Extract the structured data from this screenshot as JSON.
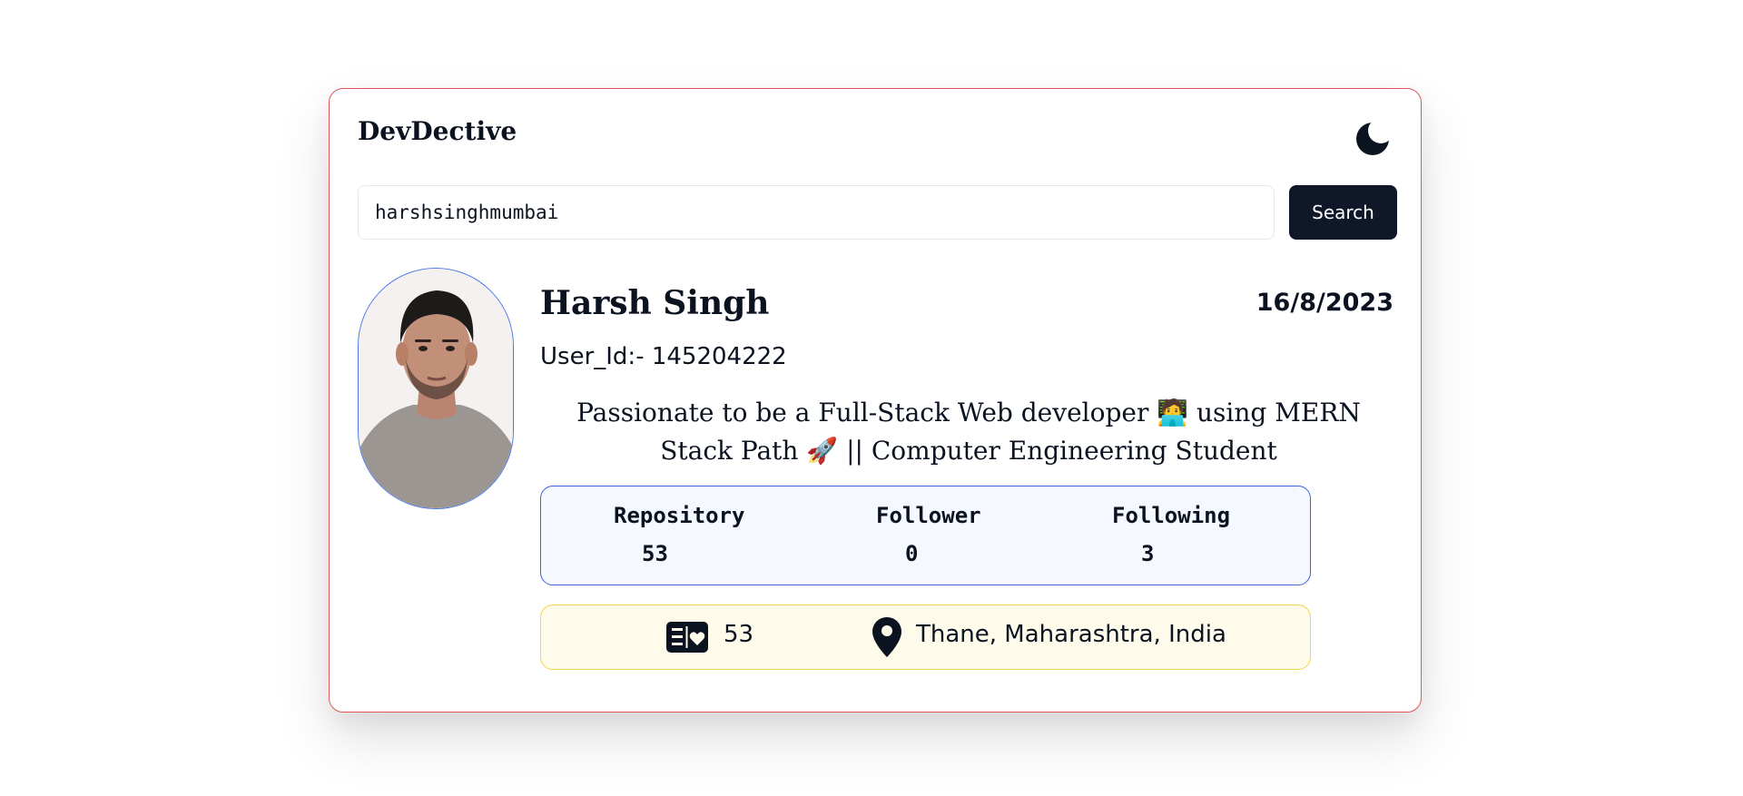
{
  "app": {
    "title": "DevDective"
  },
  "search": {
    "value": "harshsinghmumbai",
    "button_label": "Search"
  },
  "profile": {
    "name": "Harsh Singh",
    "joined": "16/8/2023",
    "user_id": "User_Id:- 145204222",
    "bio": "Passionate to be a Full-Stack Web developer 🧑‍💻 using MERN Stack Path 🚀 || Computer Engineering Student"
  },
  "stats": {
    "repository_label": "Repository",
    "repository_value": "53",
    "follower_label": "Follower",
    "follower_value": "0",
    "following_label": "Following",
    "following_value": "3"
  },
  "info": {
    "gists_count": "53",
    "location": "Thane, Maharashtra, India"
  },
  "icons": {
    "theme_toggle": "moon-icon",
    "gists": "gist-card-icon",
    "location": "map-pin-icon"
  },
  "colors": {
    "card_border": "#e0555c",
    "button_bg": "#0f1729",
    "stats_border": "#3f63d8",
    "stats_bg": "#f5f8fe",
    "info_border": "#f0d64a",
    "info_bg": "#fefbea",
    "avatar_border": "#4a78e8"
  }
}
